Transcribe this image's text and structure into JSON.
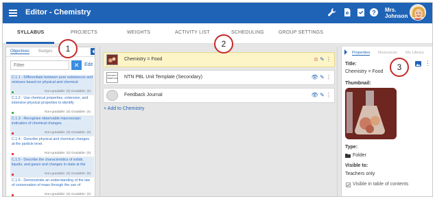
{
  "app": {
    "title": "Editor - Chemistry",
    "user_name_line1": "Mrs.",
    "user_name_line2": "Johnson",
    "accent": "#1f63b6"
  },
  "tabs": [
    {
      "label": "SYLLABUS"
    },
    {
      "label": "PROJECTS"
    },
    {
      "label": "WEIGHTS"
    },
    {
      "label": "ACTIVITY LIST"
    },
    {
      "label": "SCHEDULING"
    },
    {
      "label": "GROUP SETTINGS"
    }
  ],
  "left_panel": {
    "tab_objectives": "Objectives",
    "tab_badges": "Badges",
    "filter_placeholder": "Filter",
    "edit_label": "Edit",
    "standards": [
      {
        "text": "C.1.1 - Differentiate between pure substances and mixtures based on physical and chemical",
        "meta": "Non-gradable: (0)   Gradable: (4)",
        "dot": "#3bb54a"
      },
      {
        "text": "C.1.2 - Use chemical properties, extensive, and intensive physical properties to identify",
        "meta": "Non-gradable: (0)   Gradable: (4)",
        "dot": "#3bb54a"
      },
      {
        "text": "C.1.3 - Recognize observable macroscopic indicators of chemical changes.",
        "meta": "Non-gradable: (0)   Gradable: (0)",
        "dot": "#e53935"
      },
      {
        "text": "C.1.4 - Describe physical and chemical changes at the particle level.",
        "meta": "Non-gradable: (0)   Gradable: (0)",
        "dot": "#e53935"
      },
      {
        "text": "C.1.5 - Describe the characteristics of solids, liquids, and gases and changes in state at the",
        "meta": "Non-gradable: (0)   Gradable: (0)",
        "dot": "#e53935"
      },
      {
        "text": "C.1.6 - Demonstrate an understanding of the law of conservation of mass through the use of",
        "meta": "Non-gradable: (0)   Gradable: (0)",
        "dot": "#e53935"
      }
    ]
  },
  "middle_panel": {
    "items": [
      {
        "label": "Chemistry = Food",
        "active": true
      },
      {
        "label": "NTN PBL Unit Template (Secondary)",
        "active": false
      },
      {
        "label": "Feedback Journal",
        "active": false
      }
    ],
    "add_link": "+ Add to Chemistry",
    "thumb_template_text": "PROJECT TEMPLATE"
  },
  "right_panel": {
    "tab_properties": "Properties",
    "tab_resources": "Resources",
    "tab_library": "My Library",
    "title_label": "Title:",
    "title_value": "Chemistry = Food",
    "thumbnail_label": "Thumbnail:",
    "type_label": "Type:",
    "type_value": "Folder",
    "visible_label": "Visible to:",
    "visible_value": "Teachers only",
    "toc_label": "Visible in table of contents"
  },
  "callouts": [
    "1",
    "2",
    "3"
  ]
}
